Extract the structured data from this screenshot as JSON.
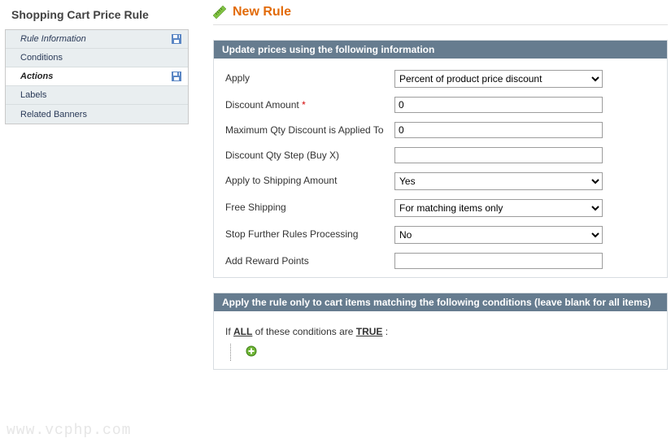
{
  "sidebar": {
    "title": "Shopping Cart Price Rule",
    "items": [
      {
        "label": "Rule Information",
        "save": true,
        "active": false,
        "italic": true
      },
      {
        "label": "Conditions",
        "save": false,
        "active": false,
        "italic": false
      },
      {
        "label": "Actions",
        "save": true,
        "active": true,
        "italic": false
      },
      {
        "label": "Labels",
        "save": false,
        "active": false,
        "italic": false
      },
      {
        "label": "Related Banners",
        "save": false,
        "active": false,
        "italic": false
      }
    ]
  },
  "header": {
    "title": "New Rule"
  },
  "fieldset1": {
    "legend": "Update prices using the following information",
    "apply": {
      "label": "Apply",
      "value": "Percent of product price discount"
    },
    "discount_amount": {
      "label": "Discount Amount",
      "value": "0",
      "required": "*"
    },
    "max_qty": {
      "label": "Maximum Qty Discount is Applied To",
      "value": "0"
    },
    "qty_step": {
      "label": "Discount Qty Step (Buy X)",
      "value": ""
    },
    "apply_shipping": {
      "label": "Apply to Shipping Amount",
      "value": "Yes"
    },
    "free_shipping": {
      "label": "Free Shipping",
      "value": "For matching items only"
    },
    "stop_rules": {
      "label": "Stop Further Rules Processing",
      "value": "No"
    },
    "reward_points": {
      "label": "Add Reward Points",
      "value": ""
    }
  },
  "fieldset2": {
    "legend": "Apply the rule only to cart items matching the following conditions (leave blank for all items)",
    "prefix": "If ",
    "all": "ALL",
    "middle": "  of these conditions are ",
    "true": "TRUE",
    "suffix": " :"
  },
  "watermark": "www.vcphp.com"
}
